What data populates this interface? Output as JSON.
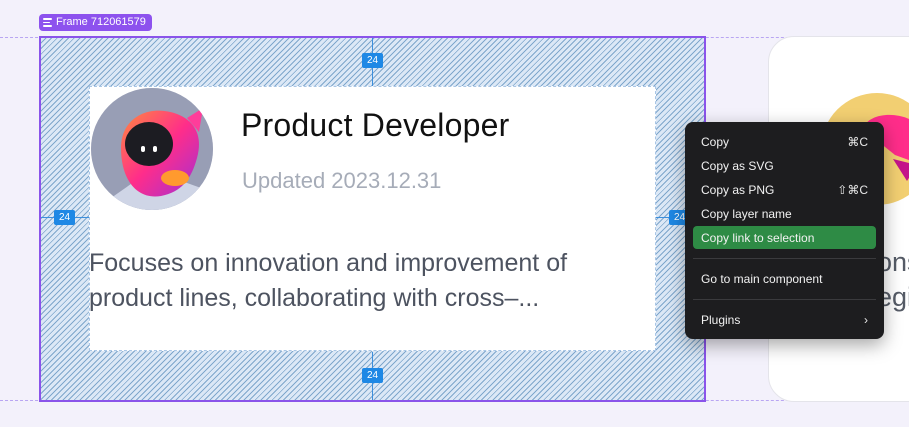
{
  "frame_label": "Frame 712061579",
  "card": {
    "title": "Product Developer",
    "updated": "Updated 2023.12.31",
    "description": "Focuses on innovation and improvement of product lines, collaborating with cross–..."
  },
  "spacing_labels": {
    "top": "24",
    "left": "24",
    "right": "24",
    "bottom": "24"
  },
  "right_card": {
    "line1": "ons",
    "line2": "egi"
  },
  "context_menu": {
    "items": [
      {
        "label": "Copy",
        "shortcut": "⌘C"
      },
      {
        "label": "Copy as SVG",
        "shortcut": ""
      },
      {
        "label": "Copy as PNG",
        "shortcut": "⇧⌘C"
      },
      {
        "label": "Copy layer name",
        "shortcut": ""
      },
      {
        "label": "Copy link to selection",
        "shortcut": ""
      },
      {
        "label": "Go to main component",
        "shortcut": ""
      },
      {
        "label": "Plugins",
        "shortcut": "›"
      }
    ],
    "highlighted": "Copy link to selection"
  },
  "colors": {
    "canvas": "#f3f1fb",
    "frame_selection": "#8a54ea",
    "spacing_badge": "#1e88e5",
    "menu_bg": "#1d1d1f",
    "menu_highlight": "#2e8b45"
  }
}
